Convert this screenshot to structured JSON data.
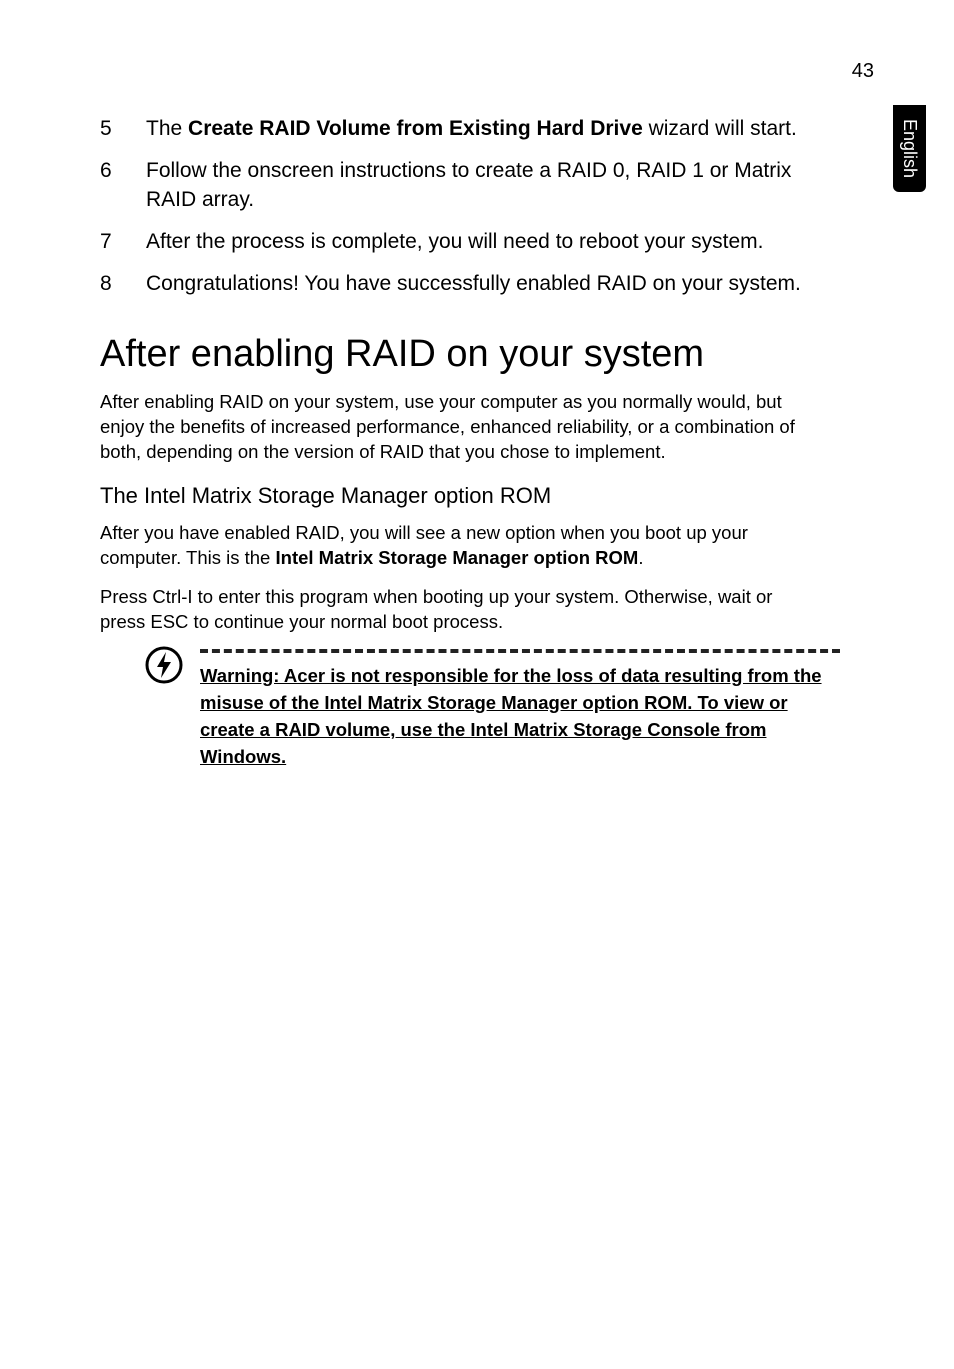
{
  "page_number": "43",
  "side_tab": "English",
  "steps": [
    {
      "pre": "The ",
      "bold": "Create RAID Volume from Existing Hard Drive",
      "post": " wizard will start."
    },
    {
      "text": "Follow the onscreen instructions to create a RAID 0, RAID 1 or Matrix RAID array."
    },
    {
      "text": "After the process is complete, you will need to reboot your system."
    },
    {
      "text": "Congratulations! You have successfully enabled RAID on your system."
    }
  ],
  "section_heading": "After enabling RAID on your system",
  "section_para": "After enabling RAID on your system, use your computer as you normally would, but enjoy the benefits of increased performance, enhanced reliability, or a combination of both, depending on the version of RAID that you chose to implement.",
  "sub_heading": "The Intel Matrix Storage Manager option ROM",
  "sub_para1_pre": "After you have enabled RAID, you will see a new option when you boot up your computer. This is the ",
  "sub_para1_bold": "Intel Matrix Storage Manager option ROM",
  "sub_para1_post": ".",
  "sub_para2": "Press Ctrl-I to enter this program when booting up your system. Otherwise, wait or press ESC to continue your normal boot process.",
  "warning": "Warning: Acer is not responsible for the loss of data resulting from the misuse of the Intel Matrix Storage Manager option ROM. To view or create a RAID volume, use the Intel Matrix Storage Console from Windows."
}
